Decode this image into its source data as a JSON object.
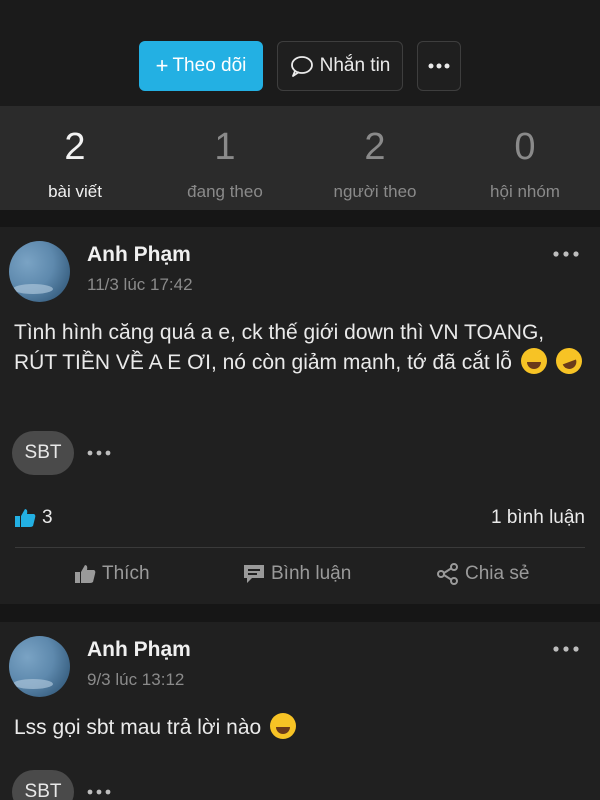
{
  "actions": {
    "follow_plus": "+",
    "follow_label": "Theo dõi",
    "message_label": "Nhắn tin",
    "more_icon": "more-horizontal-icon"
  },
  "stats": [
    {
      "value": "2",
      "label": "bài viết"
    },
    {
      "value": "1",
      "label": "đang theo"
    },
    {
      "value": "2",
      "label": "người theo"
    },
    {
      "value": "0",
      "label": "hội nhóm"
    }
  ],
  "posts": [
    {
      "author": "Anh Phạm",
      "time": "11/3 lúc 17:42",
      "text": "Tình hình căng quá a e, ck thế giới down thì VN TOANG, RÚT TIỀN VỀ A E ƠI, nó còn giảm mạnh, tớ đã cắt lỗ",
      "tag": "SBT",
      "likes": "3",
      "comments": "1 bình luận",
      "like_label": "Thích",
      "comment_label": "Bình luận",
      "share_label": "Chia sẻ"
    },
    {
      "author": "Anh Phạm",
      "time": "9/3 lúc 13:12",
      "text": "Lss gọi sbt mau trả lời nào",
      "tag": "SBT"
    }
  ],
  "colors": {
    "accent": "#23b0e3",
    "background": "#161616",
    "card": "#202020",
    "stats_bar": "#2b2b2b"
  }
}
